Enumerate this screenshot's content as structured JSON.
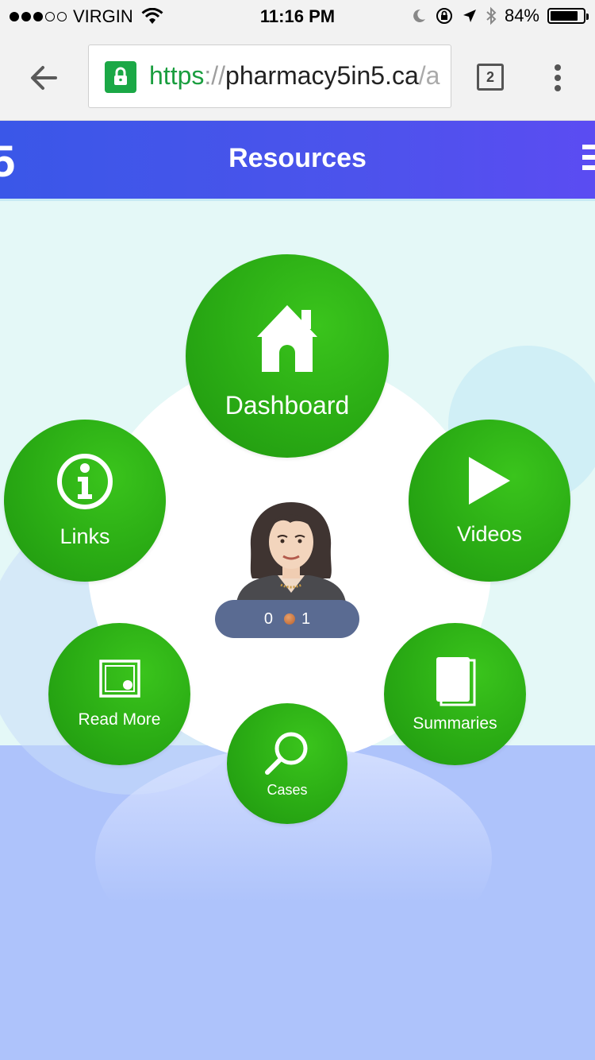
{
  "status_bar": {
    "carrier": "VIRGIN",
    "time": "11:16 PM",
    "battery": "84%",
    "battery_level": 0.84,
    "signal_bars_filled": 3,
    "signal_bars_total": 5
  },
  "browser": {
    "url_scheme": "https",
    "url_separator": "://",
    "url_host": "pharmacy5in5.ca",
    "url_rest": "/a",
    "tab_count": "2"
  },
  "header": {
    "logo_fragment": "5",
    "title": "Resources"
  },
  "menu": {
    "dashboard": "Dashboard",
    "links": "Links",
    "videos": "Videos",
    "read_more": "Read More",
    "summaries": "Summaries",
    "cases": "Cases"
  },
  "score": {
    "left": "0",
    "right": "1"
  },
  "colors": {
    "header_start": "#3a57e8",
    "header_end": "#5b4cf2",
    "button_green": "#2aab14",
    "upper_background": "#e4f8f7",
    "lower_background": "#aec3fb",
    "score_pill": "#5a6b92"
  },
  "icons": {
    "dashboard": "home-icon",
    "links": "info-icon",
    "videos": "play-icon",
    "read_more": "image-icon",
    "summaries": "book-icon",
    "cases": "search-icon"
  }
}
